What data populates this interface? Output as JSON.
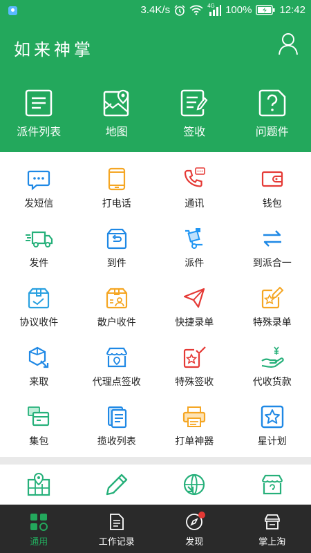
{
  "status": {
    "speed": "3.4K/s",
    "network": "4G",
    "battery": "100%",
    "time": "12:42"
  },
  "header": {
    "title": "如来神掌"
  },
  "top_actions": [
    {
      "label": "派件列表",
      "icon": "list-doc-icon"
    },
    {
      "label": "地图",
      "icon": "map-icon"
    },
    {
      "label": "签收",
      "icon": "sign-doc-icon"
    },
    {
      "label": "问题件",
      "icon": "question-doc-icon"
    }
  ],
  "grid": [
    {
      "label": "发短信",
      "icon": "sms-icon",
      "color": "#1e88e5"
    },
    {
      "label": "打电话",
      "icon": "phone-tablet-icon",
      "color": "#f5a623"
    },
    {
      "label": "通讯",
      "icon": "call-icon",
      "color": "#e53935"
    },
    {
      "label": "钱包",
      "icon": "wallet-icon",
      "color": "#e53935"
    },
    {
      "label": "发件",
      "icon": "truck-icon",
      "color": "#26b07a"
    },
    {
      "label": "到件",
      "icon": "return-box-icon",
      "color": "#1e88e5"
    },
    {
      "label": "派件",
      "icon": "hand-truck-icon",
      "color": "#2196f3"
    },
    {
      "label": "到派合一",
      "icon": "swap-arrows-icon",
      "color": "#1e88e5"
    },
    {
      "label": "协议收件",
      "icon": "box-contract-icon",
      "color": "#29a0e0"
    },
    {
      "label": "散户收件",
      "icon": "box-person-icon",
      "color": "#f5a623"
    },
    {
      "label": "快捷录单",
      "icon": "paper-plane-icon",
      "color": "#e53935"
    },
    {
      "label": "特殊录单",
      "icon": "star-edit-icon",
      "color": "#f5a623"
    },
    {
      "label": "来取",
      "icon": "pickup-icon",
      "color": "#1e88e5"
    },
    {
      "label": "代理点签收",
      "icon": "store-location-icon",
      "color": "#1e88e5"
    },
    {
      "label": "特殊签收",
      "icon": "star-check-icon",
      "color": "#e53935"
    },
    {
      "label": "代收货款",
      "icon": "cash-hand-icon",
      "color": "#26b07a"
    },
    {
      "label": "集包",
      "icon": "package-stack-icon",
      "color": "#26b07a"
    },
    {
      "label": "揽收列表",
      "icon": "collect-list-icon",
      "color": "#1e88e5"
    },
    {
      "label": "打单神器",
      "icon": "printer-icon",
      "color": "#f5a623"
    },
    {
      "label": "星计划",
      "icon": "star-square-icon",
      "color": "#1e88e5"
    }
  ],
  "grid2": [
    {
      "icon": "map-pin-icon",
      "color": "#26b07a"
    },
    {
      "icon": "pencil-icon",
      "color": "#26b07a"
    },
    {
      "icon": "globe-icon",
      "color": "#26b07a"
    },
    {
      "icon": "store-question-icon",
      "color": "#26b07a"
    }
  ],
  "nav": [
    {
      "label": "通用",
      "icon": "grid-icon",
      "active": true
    },
    {
      "label": "工作记录",
      "icon": "document-icon",
      "active": false
    },
    {
      "label": "发现",
      "icon": "compass-icon",
      "active": false
    },
    {
      "label": "掌上淘",
      "icon": "shop-icon",
      "active": false
    }
  ]
}
